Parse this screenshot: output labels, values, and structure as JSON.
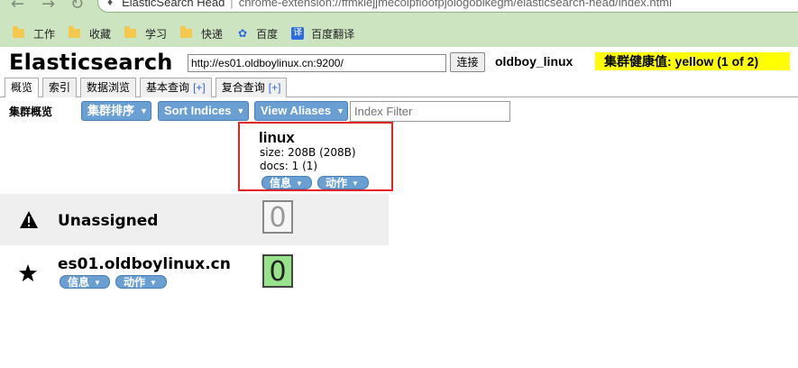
{
  "browser": {
    "tab_title": "ElasticSearch Head",
    "url_scheme": "chrome-extension://ffmkiejjmecolpfloofpjologoblkegm/elasticsearch-head/index.html",
    "bookmarks": [
      {
        "label": "工作",
        "icon": "folder-icon"
      },
      {
        "label": "收藏",
        "icon": "folder-icon"
      },
      {
        "label": "学习",
        "icon": "folder-icon"
      },
      {
        "label": "快递",
        "icon": "folder-icon"
      },
      {
        "label": "百度",
        "icon": "baidu-icon"
      },
      {
        "label": "百度翻译",
        "icon": "fanyi-icon"
      }
    ]
  },
  "header": {
    "title": "Elasticsearch",
    "es_url": "http://es01.oldboylinux.cn:9200/",
    "connect_label": "连接",
    "cluster_name": "oldboy_linux",
    "health": "集群健康值: yellow (1 of 2)",
    "health_color": "#ffff00"
  },
  "tabs": [
    {
      "label": "概览",
      "active": true
    },
    {
      "label": "索引"
    },
    {
      "label": "数据浏览"
    },
    {
      "label": "基本查询",
      "plus": "[+]"
    },
    {
      "label": "复合查询",
      "plus": "[+]"
    }
  ],
  "toolbar": {
    "label": "集群概览",
    "sort_cluster": "集群排序",
    "sort_indices": "Sort Indices",
    "view_aliases": "View Aliases",
    "filter_placeholder": "Index Filter"
  },
  "index": {
    "name": "linux",
    "size": "size: 208B (208B)",
    "docs": "docs: 1 (1)",
    "info_label": "信息",
    "action_label": "动作"
  },
  "rows": {
    "unassigned_label": "Unassigned",
    "unassigned_shard": "0",
    "node_name": "es01.oldboylinux.cn",
    "node_shard": "0",
    "node_info_label": "信息",
    "node_action_label": "动作"
  },
  "colors": {
    "button_blue": "#6a9fd4",
    "shard_started": "#99e28c",
    "highlight_box": "#e3242b"
  }
}
